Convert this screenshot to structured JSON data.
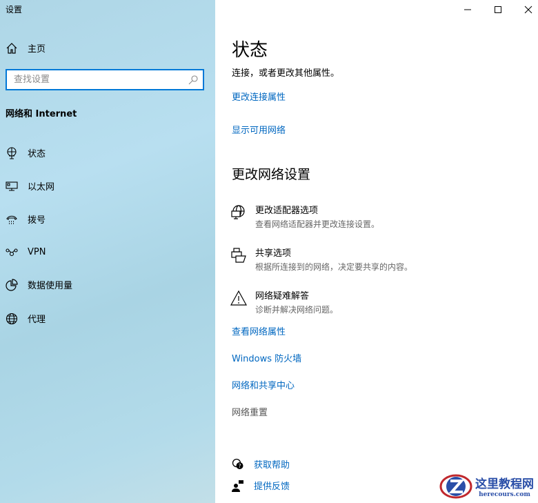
{
  "window": {
    "title": "设置",
    "minimize": "minimize-icon",
    "maximize": "maximize-icon",
    "close": "close-icon"
  },
  "sidebar": {
    "home": "主页",
    "search_placeholder": "查找设置",
    "section": "网络和 Internet",
    "items": [
      {
        "label": "状态",
        "icon": "status-globe-icon"
      },
      {
        "label": "以太网",
        "icon": "ethernet-icon"
      },
      {
        "label": "拨号",
        "icon": "dialup-icon"
      },
      {
        "label": "VPN",
        "icon": "vpn-icon"
      },
      {
        "label": "数据使用量",
        "icon": "data-usage-icon"
      },
      {
        "label": "代理",
        "icon": "proxy-globe-icon"
      }
    ]
  },
  "main": {
    "title": "状态",
    "subtitle": "连接，或者更改其他属性。",
    "links_top": [
      "更改连接属性",
      "显示可用网络"
    ],
    "heading": "更改网络设置",
    "options": [
      {
        "title": "更改适配器选项",
        "desc": "查看网络适配器并更改连接设置。"
      },
      {
        "title": "共享选项",
        "desc": "根据所连接到的网络，决定要共享的内容。"
      },
      {
        "title": "网络疑难解答",
        "desc": "诊断并解决网络问题。"
      }
    ],
    "links": [
      "查看网络属性",
      "Windows 防火墙",
      "网络和共享中心"
    ],
    "reset": "网络重置",
    "help": "获取帮助",
    "feedback": "提供反馈"
  },
  "watermark": {
    "name": "这里教程网",
    "url": "herecours.com"
  },
  "colors": {
    "accent": "#0078d7",
    "link": "#0067c0"
  }
}
